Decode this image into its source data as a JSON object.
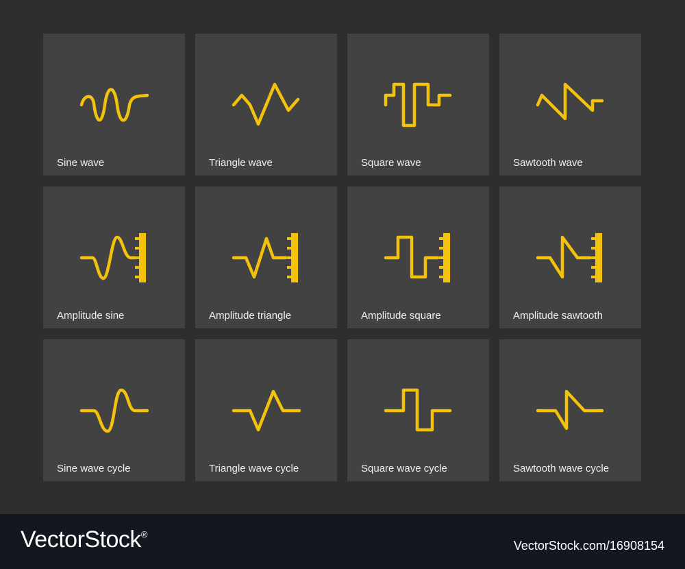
{
  "colors": {
    "background": "#2e2e2e",
    "tile": "#424242",
    "icon": "#f2c20c",
    "footer": "#131720"
  },
  "tiles": [
    {
      "label": "Sine wave",
      "icon": "sine-wave-icon"
    },
    {
      "label": "Triangle wave",
      "icon": "triangle-wave-icon"
    },
    {
      "label": "Square wave",
      "icon": "square-wave-icon"
    },
    {
      "label": "Sawtooth wave",
      "icon": "sawtooth-wave-icon"
    },
    {
      "label": "Amplitude sine",
      "icon": "amplitude-sine-icon"
    },
    {
      "label": "Amplitude triangle",
      "icon": "amplitude-triangle-icon"
    },
    {
      "label": "Amplitude square",
      "icon": "amplitude-square-icon"
    },
    {
      "label": "Amplitude sawtooth",
      "icon": "amplitude-sawtooth-icon"
    },
    {
      "label": "Sine wave cycle",
      "icon": "sine-wave-cycle-icon"
    },
    {
      "label": "Triangle wave cycle",
      "icon": "triangle-wave-cycle-icon"
    },
    {
      "label": "Square wave cycle",
      "icon": "square-wave-cycle-icon"
    },
    {
      "label": "Sawtooth wave cycle",
      "icon": "sawtooth-wave-cycle-icon"
    }
  ],
  "footer": {
    "brand": "VectorStock",
    "trademark": "®",
    "stock_id": "VectorStock.com/16908154"
  }
}
